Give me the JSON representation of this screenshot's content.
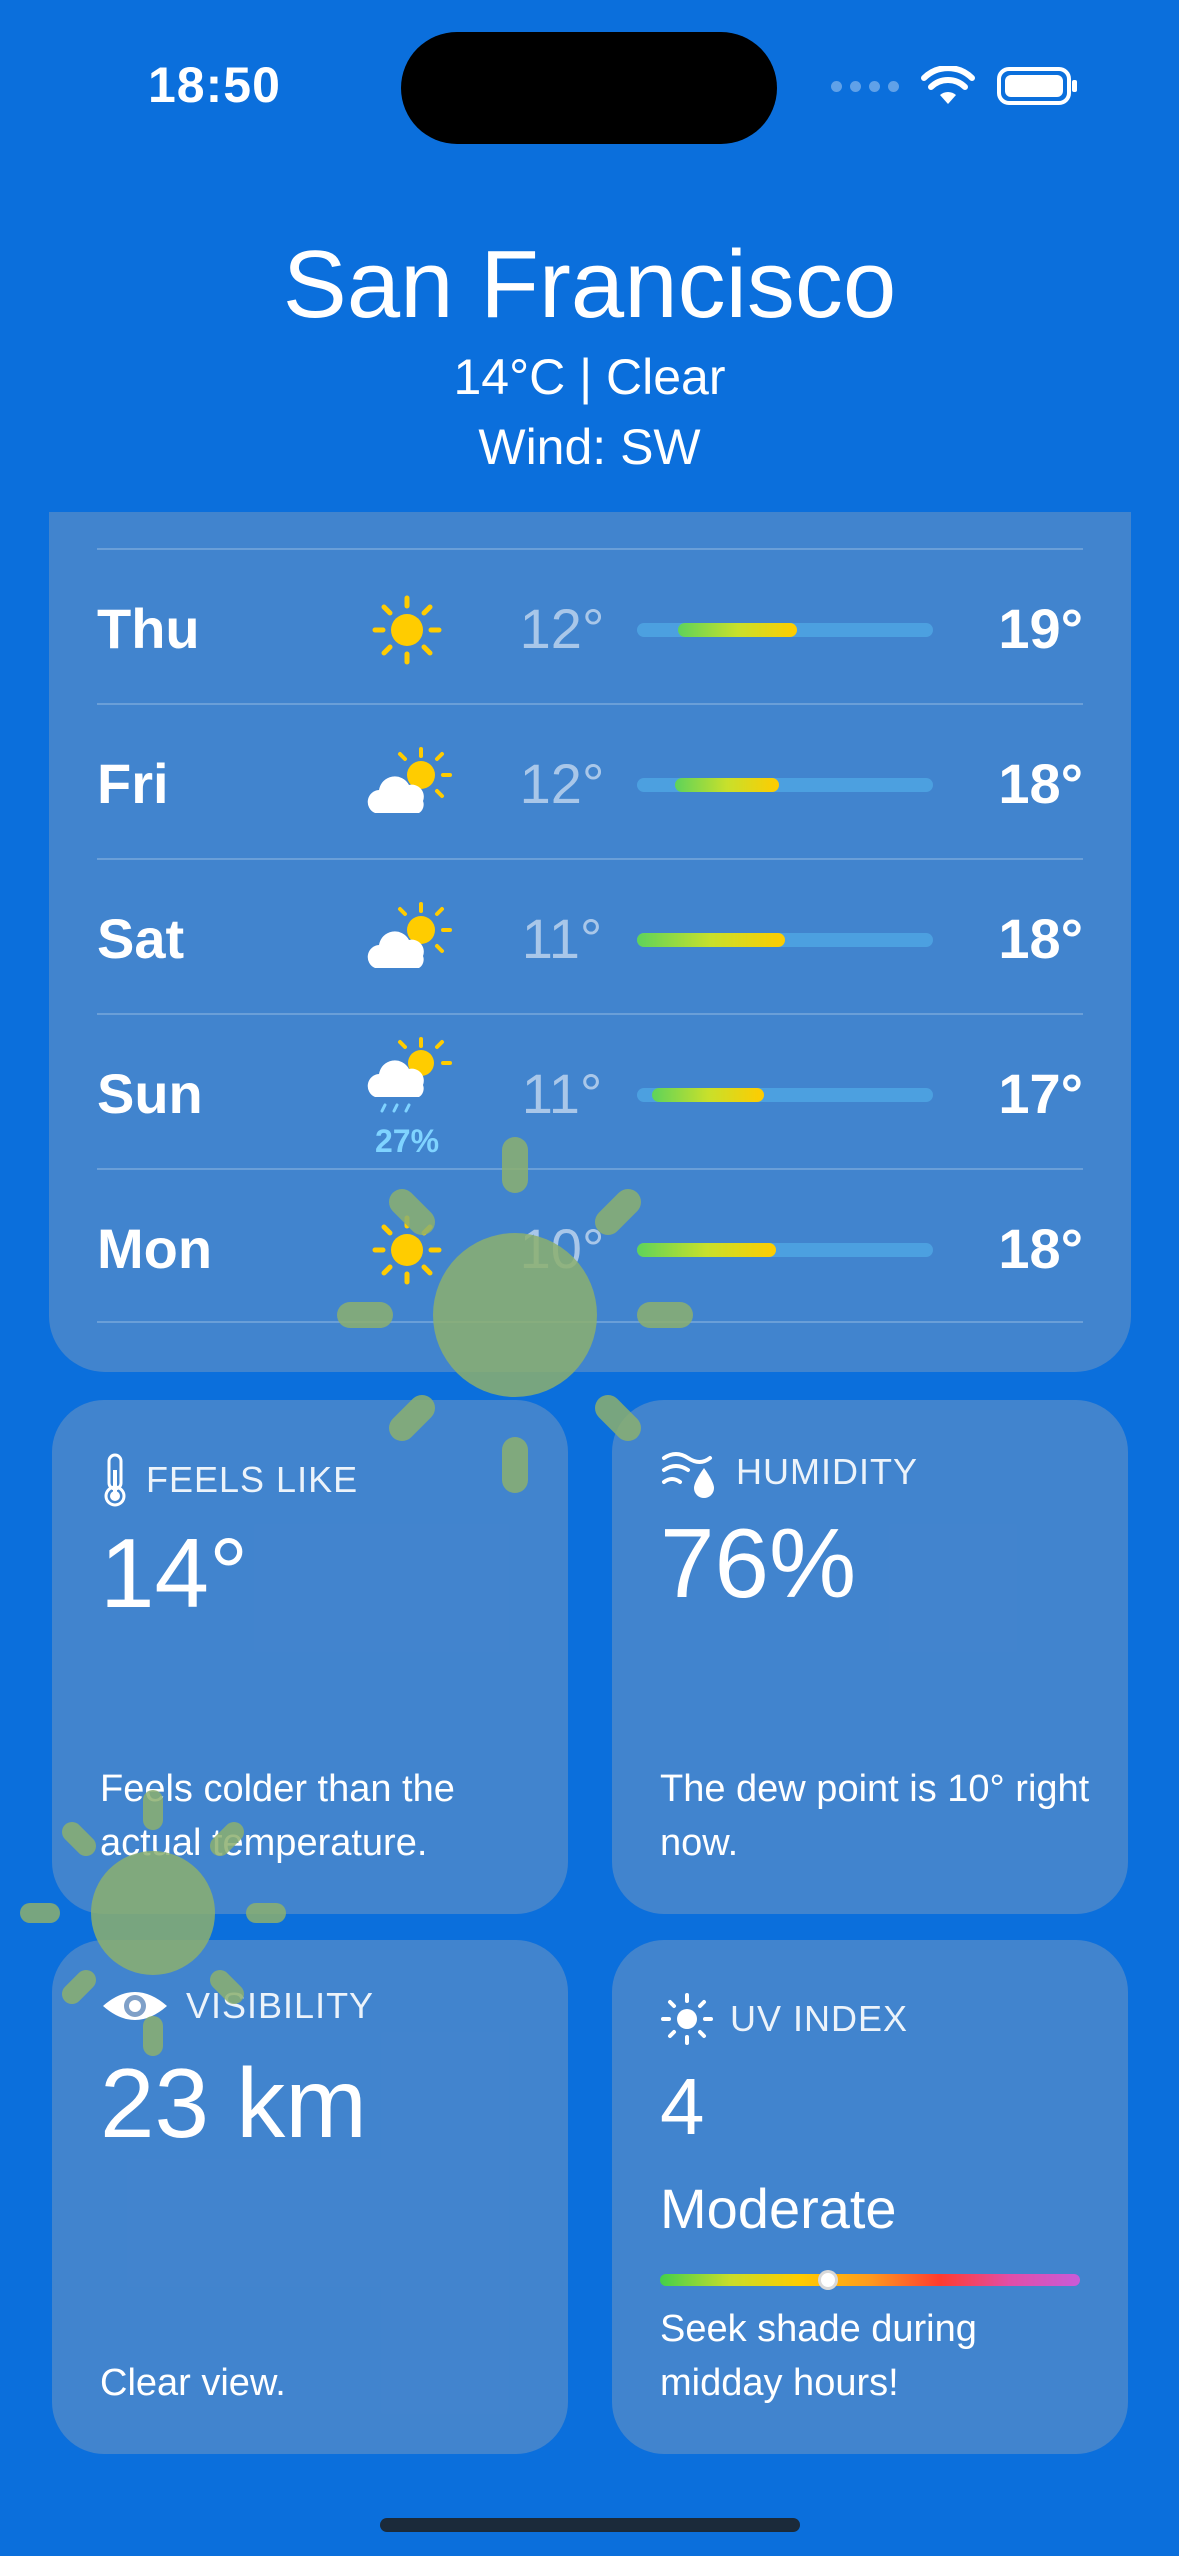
{
  "status_bar": {
    "time": "18:50"
  },
  "header": {
    "city": "San Francisco",
    "summary": "14°C | Clear",
    "wind": "Wind: SW"
  },
  "forecast": [
    {
      "day": "Thu",
      "icon": "sun-icon",
      "low": "12°",
      "high": "19°",
      "range": [
        0.14,
        0.54
      ]
    },
    {
      "day": "Fri",
      "icon": "partly-cloudy-icon",
      "low": "12°",
      "high": "18°",
      "range": [
        0.13,
        0.48
      ]
    },
    {
      "day": "Sat",
      "icon": "partly-cloudy-icon",
      "low": "11°",
      "high": "18°",
      "range": [
        0.0,
        0.5
      ]
    },
    {
      "day": "Sun",
      "icon": "partly-cloudy-rain-icon",
      "low": "11°",
      "high": "17°",
      "precip": "27%",
      "range": [
        0.05,
        0.43
      ]
    },
    {
      "day": "Mon",
      "icon": "sun-icon",
      "low": "10°",
      "high": "18°",
      "range": [
        0.0,
        0.47
      ]
    }
  ],
  "tiles": {
    "feels_like": {
      "title": "FEELS LIKE",
      "value": "14°",
      "description": "Feels colder than the actual temperature."
    },
    "humidity": {
      "title": "HUMIDITY",
      "value": "76%",
      "description": "The dew point is 10° right now."
    },
    "visibility": {
      "title": "VISIBILITY",
      "value": "23 km",
      "description": "Clear view."
    },
    "uv_index": {
      "title": "UV INDEX",
      "value": "4",
      "level": "Moderate",
      "description": "Seek shade during midday hours!",
      "position": 0.4
    }
  },
  "colors": {
    "background": "#0b6fdc",
    "sun": "#ffcc00",
    "precip": "#7fd3ff"
  }
}
